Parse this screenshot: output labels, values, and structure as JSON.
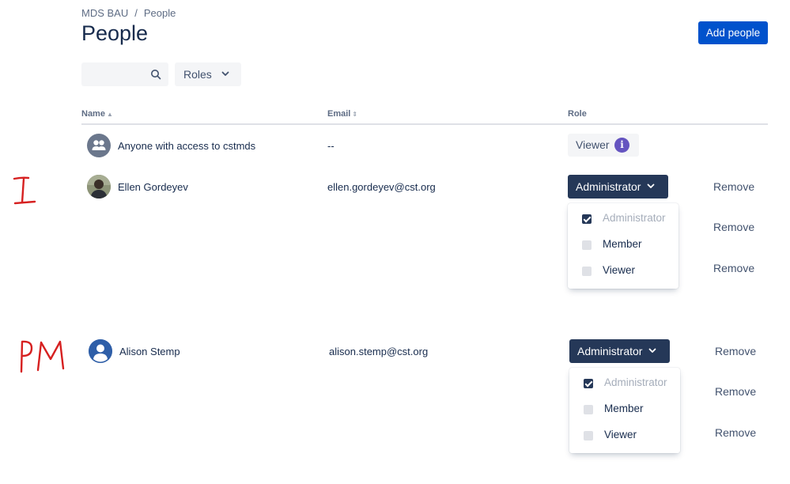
{
  "breadcrumb": {
    "project": "MDS BAU",
    "separator": "/",
    "current": "People"
  },
  "page_title": "People",
  "add_button_label": "Add people",
  "search": {
    "placeholder": "",
    "icon": "search-icon"
  },
  "roles_filter_label": "Roles",
  "table": {
    "columns": {
      "name": "Name",
      "email": "Email",
      "role": "Role"
    },
    "rows": [
      {
        "name": "Anyone with access to cstmds",
        "email": "--",
        "role": "Viewer"
      },
      {
        "name": "Ellen Gordeyev",
        "email": "ellen.gordeyev@cst.org",
        "role": "Administrator"
      },
      {
        "name": "Alison Stemp",
        "email": "alison.stemp@cst.org",
        "role": "Administrator"
      }
    ]
  },
  "role_menu_options": [
    "Administrator",
    "Member",
    "Viewer"
  ],
  "remove_label": "Remove",
  "annotations": {
    "first": "I",
    "second": "PM"
  },
  "colors": {
    "primary": "#0052cc",
    "dark": "#253858",
    "info": "#6554c0",
    "annotation": "#d62020"
  }
}
